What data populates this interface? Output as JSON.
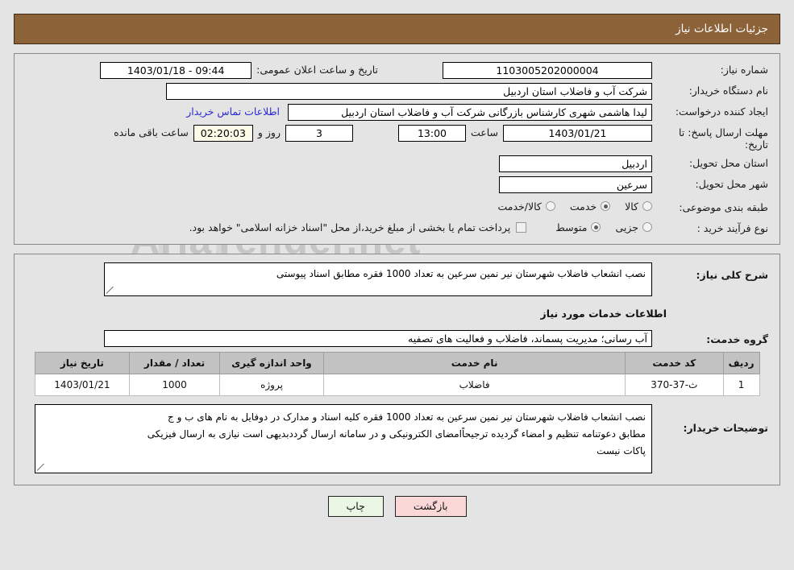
{
  "header": {
    "title": "جزئیات اطلاعات نیاز"
  },
  "form": {
    "need_number_label": "شماره نیاز:",
    "need_number_value": "1103005202000004",
    "public_announce_label": "تاریخ و ساعت اعلان عمومی:",
    "public_announce_value": "1403/01/18 - 09:44",
    "buyer_org_label": "نام دستگاه خریدار:",
    "buyer_org_value": "شرکت آب و فاضلاب استان اردبیل",
    "requester_label": "ایجاد کننده درخواست:",
    "requester_value": "لیدا  هاشمی شهری کارشناس بازرگانی شرکت آب و فاضلاب استان اردبیل",
    "requester_org_value": "شرکت آب و فاضلاب استان اردبیل",
    "contact_link": "اطلاعات تماس خریدار",
    "deadline_label": "مهلت ارسال پاسخ: تا تاریخ:",
    "deadline_date": "1403/01/21",
    "hour_label": "ساعت",
    "deadline_time": "13:00",
    "days_value": "3",
    "days_label": "روز و",
    "countdown_value": "02:20:03",
    "remaining_label": "ساعت باقی مانده",
    "province_label": "استان محل تحویل:",
    "province_value": "اردبیل",
    "city_label": "شهر محل تحویل:",
    "city_value": "سرعین",
    "category_label": "طبقه بندی موضوعی:",
    "category_options": [
      {
        "label": "کالا",
        "selected": false
      },
      {
        "label": "خدمت",
        "selected": true
      },
      {
        "label": "کالا/خدمت",
        "selected": false
      }
    ],
    "process_label": "نوع فرآیند خرید :",
    "process_options": [
      {
        "label": "جزیی",
        "selected": false
      },
      {
        "label": "متوسط",
        "selected": true
      }
    ],
    "treasury_checkbox_label": "پرداخت تمام یا بخشی از مبلغ خرید،از محل \"اسناد خزانه اسلامی\" خواهد بود.",
    "treasury_checked": false
  },
  "need_desc": {
    "label": "شرح کلی نیاز:",
    "value": "نصب انشعاب فاضلاب شهرستان نیر نمین سرعین به تعداد 1000 فقره مطابق اسناد پیوستی"
  },
  "services_section": {
    "heading": "اطلاعات خدمات مورد نیاز",
    "group_label": "گروه خدمت:",
    "group_value": "آب رسانی؛ مدیریت پسماند، فاضلاب و فعالیت های تصفیه"
  },
  "table": {
    "headers": [
      "ردیف",
      "کد خدمت",
      "نام خدمت",
      "واحد اندازه گیری",
      "تعداد / مقدار",
      "تاریخ نیاز"
    ],
    "rows": [
      {
        "index": "1",
        "service_code": "ث-37-370",
        "service_name": "فاضلاب",
        "unit": "پروژه",
        "quantity": "1000",
        "need_date": "1403/01/21"
      }
    ]
  },
  "buyer_notes": {
    "label": "توضیحات خریدار:",
    "lines": [
      "نصب انشعاب فاضلاب شهرستان نیر نمین سرعین به تعداد 1000 فقره کلیه اسناد و مدارک در دوفایل به نام های ب و ج",
      "مطابق دعوتنامه تنظیم و امضاء گردیده ترجیحاًامضای الکترونیکی و در سامانه ارسال گرددبدیهی است نیازی به ارسال فیزیکی",
      "پاکات نیست"
    ]
  },
  "buttons": {
    "print": "چاپ",
    "back": "بازگشت"
  },
  "watermark": {
    "text": "AriaTender.net"
  }
}
